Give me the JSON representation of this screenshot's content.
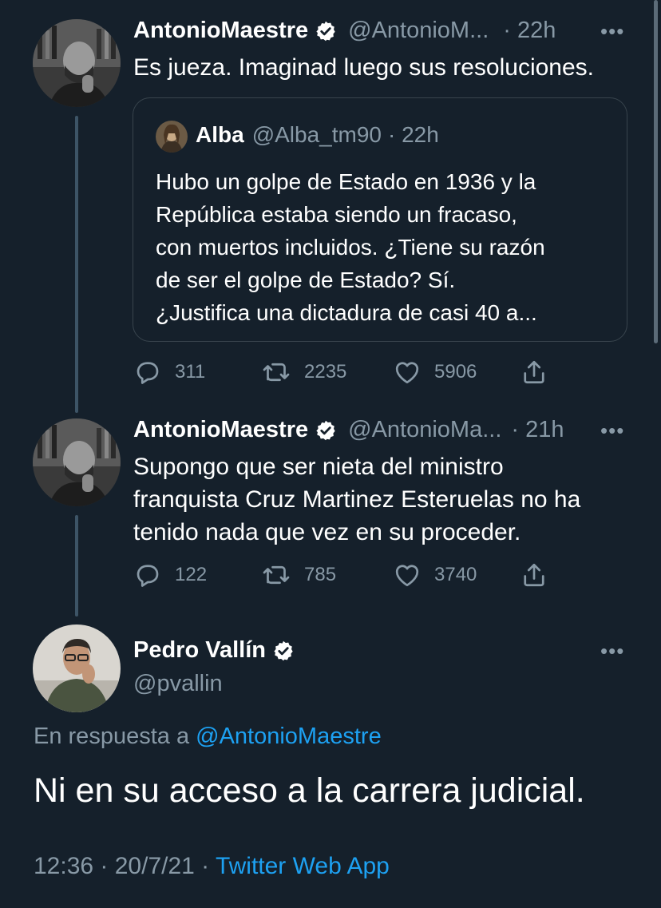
{
  "tweets": [
    {
      "name": "AntonioMaestre",
      "handle": "@AntonioM...",
      "time": "· 22h",
      "text": "Es jueza. Imaginad luego sus resoluciones.",
      "quote": {
        "name": "Alba",
        "handle": "@Alba_tm90",
        "time": "· 22h",
        "lines": [
          "Hubo un golpe de Estado en 1936 y la",
          "República estaba siendo un fracaso,",
          "con muertos incluidos. ¿Tiene su razón",
          "de ser el golpe de Estado? Sí.",
          "¿Justifica una dictadura de casi 40 a..."
        ]
      },
      "replies": "311",
      "retweets": "2235",
      "likes": "5906"
    },
    {
      "name": "AntonioMaestre",
      "handle": "@AntonioMa...",
      "time": "· 21h",
      "lines": [
        "Supongo que ser nieta del ministro",
        "franquista Cruz Martinez Esteruelas no ha",
        "tenido nada que vez en su proceder."
      ],
      "replies": "122",
      "retweets": "785",
      "likes": "3740"
    }
  ],
  "main_tweet": {
    "name": "Pedro Vallín",
    "handle": "@pvallin",
    "reply_prefix": "En respuesta a",
    "reply_to": "@AntonioMaestre",
    "text": "Ni en su acceso a la carrera judicial.",
    "timestamp": "12:36 · 20/7/21 ·",
    "source": "Twitter Web App"
  },
  "icons": {
    "more": "more-horizontal-icon",
    "verified": "verified-badge-icon",
    "reply": "reply-icon",
    "retweet": "retweet-icon",
    "like": "heart-icon",
    "share": "share-icon"
  },
  "colors": {
    "background": "#15202b",
    "secondary_text": "#8899a6",
    "link": "#1da1f2",
    "border": "#38444d"
  }
}
